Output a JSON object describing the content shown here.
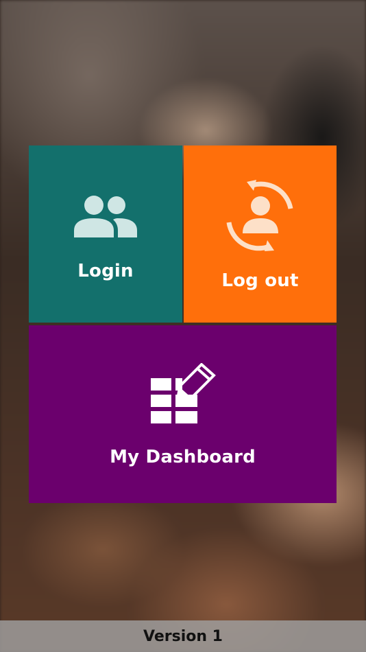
{
  "tiles": {
    "login": {
      "label": "Login",
      "icon": "user-group-icon",
      "color": "#13706c"
    },
    "logout": {
      "label": "Log out",
      "icon": "user-sync-icon",
      "color": "#ff6f0b"
    },
    "dashboard": {
      "label": "My Dashboard",
      "icon": "grid-edit-icon",
      "color": "#6b006d"
    }
  },
  "footer": {
    "version_label": "Version 1"
  },
  "icon_color": "#cfe6e4"
}
